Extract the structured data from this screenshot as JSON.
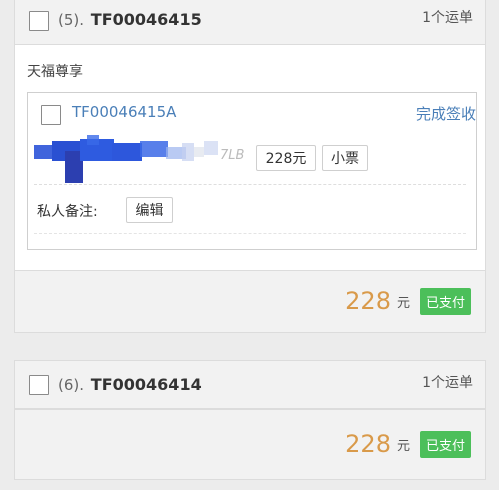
{
  "orders": [
    {
      "index": "(5).",
      "code": "TF00046415",
      "count": "1个运单",
      "shop": "天福尊享",
      "package": {
        "code": "TF00046415A",
        "status": "完成签收",
        "weight": "7LB",
        "price": "228元",
        "ticket": "小票"
      },
      "note_label": "私人备注:",
      "edit_label": "编辑",
      "total": "228",
      "currency": "元",
      "pay_status": "已支付"
    },
    {
      "index": "(6).",
      "code": "TF00046414",
      "count": "1个运单",
      "total": "228",
      "currency": "元",
      "pay_status": "已支付"
    }
  ],
  "colors": {
    "link_blue": "#4a7fb8",
    "amount_orange": "#d99a4a",
    "paid_green": "#4cbf5a",
    "redaction_blue": "#2b53d8"
  }
}
